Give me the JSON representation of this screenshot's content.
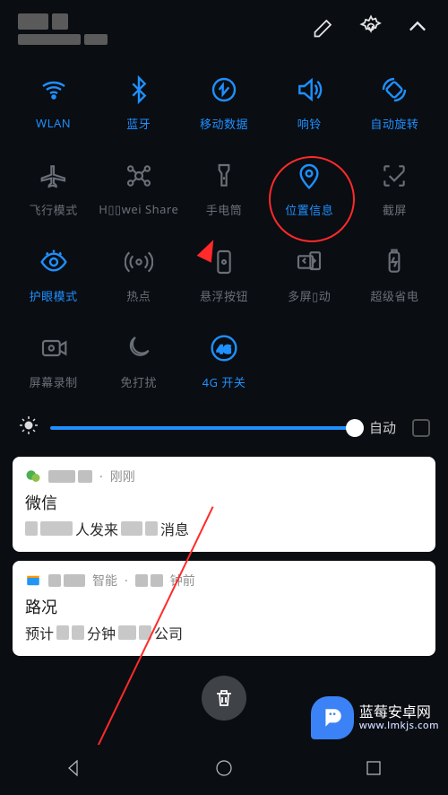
{
  "header": {
    "edit_label": "edit",
    "settings_label": "settings",
    "collapse_label": "collapse"
  },
  "toggles": [
    {
      "id": "wifi",
      "label": "WLAN",
      "icon": "wifi-icon",
      "active": true
    },
    {
      "id": "bluetooth",
      "label": "蓝牙",
      "icon": "bluetooth-icon",
      "active": true
    },
    {
      "id": "mobile-data",
      "label": "移动数据",
      "icon": "mobile-data-icon",
      "active": true
    },
    {
      "id": "ringer",
      "label": "响铃",
      "icon": "sound-icon",
      "active": true
    },
    {
      "id": "rotation",
      "label": "自动旋转",
      "icon": "rotation-icon",
      "active": true
    },
    {
      "id": "airplane",
      "label": "飞行模式",
      "icon": "airplane-icon",
      "active": false
    },
    {
      "id": "huawei-share",
      "label": "H▯▯wei Share",
      "icon": "share-icon",
      "active": false
    },
    {
      "id": "flashlight",
      "label": "手电筒",
      "icon": "flashlight-icon",
      "active": false
    },
    {
      "id": "location",
      "label": "位置信息",
      "icon": "location-icon",
      "active": true,
      "highlighted": true
    },
    {
      "id": "screenshot",
      "label": "截屏",
      "icon": "screenshot-icon",
      "active": false
    },
    {
      "id": "eye-comfort",
      "label": "护眼模式",
      "icon": "eye-icon",
      "active": true
    },
    {
      "id": "hotspot",
      "label": "热点",
      "icon": "hotspot-icon",
      "active": false
    },
    {
      "id": "floating-dock",
      "label": "悬浮按钮",
      "icon": "floating-icon",
      "active": false
    },
    {
      "id": "multi-screen",
      "label": "多屏▯动",
      "icon": "multiscreen-icon",
      "active": false
    },
    {
      "id": "ultra-battery",
      "label": "超级省电",
      "icon": "battery-icon",
      "active": false
    },
    {
      "id": "screen-record",
      "label": "屏幕录制",
      "icon": "record-icon",
      "active": false
    },
    {
      "id": "dnd",
      "label": "免打扰",
      "icon": "dnd-icon",
      "active": false
    },
    {
      "id": "4g-switch",
      "label": "4G 开关",
      "icon": "fourg-icon",
      "active": true
    }
  ],
  "brightness": {
    "value": 100,
    "auto_label": "自动",
    "auto_checked": false
  },
  "notifications": [
    {
      "app": "wechat",
      "time": "刚刚",
      "title": "微信",
      "body_prefix": "▯▯▯",
      "body_mid": "人发来",
      "body_suffix": "消息"
    },
    {
      "app": "smart",
      "time": "钟前",
      "title": "路况",
      "body_prefix": "预计",
      "body_mid": "分钟",
      "body_suffix": "公司"
    }
  ],
  "annotation": {
    "target": "location",
    "shape": "circle",
    "arrow": true,
    "color": "#ff2a2a"
  },
  "watermark": {
    "brand": "蓝莓安卓网",
    "url": "www.lmkjs.com"
  },
  "clear_all": "clear-all",
  "nav": {
    "back": "back",
    "home": "home",
    "recents": "recents"
  }
}
